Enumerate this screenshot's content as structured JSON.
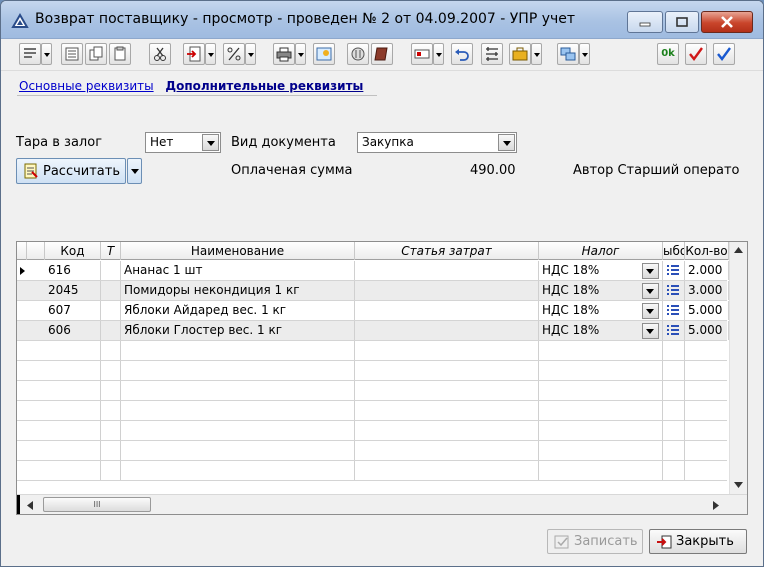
{
  "window": {
    "title": "Возврат поставщику - просмотр - проведен № 2 от 04.09.2007 - УПР учет"
  },
  "toolbar": {
    "ok_label": "0k"
  },
  "tabs": {
    "basic": "Основные реквизиты",
    "extra": "Дополнительные реквизиты"
  },
  "form": {
    "tara_label": "Тара в залог",
    "tara_value": "Нет",
    "doc_type_label": "Вид документа",
    "doc_type_value": "Закупка",
    "calc_button": "Рассчитать",
    "paid_label": "Оплаченая сумма",
    "paid_value": "490.00",
    "author_label": "Автор",
    "author_value": "Старший оператор"
  },
  "grid": {
    "headers": {
      "code": "Код",
      "t": "Т",
      "name": "Наименование",
      "cost_item": "Статья затрат",
      "tax": "Налог",
      "unit": "ыбо",
      "qty": "Кол-во"
    },
    "rows": [
      {
        "code": "616",
        "name": "Ананас 1 шт",
        "tax": "НДС 18%",
        "qty": "2.000"
      },
      {
        "code": "2045",
        "name": "Помидоры некондиция 1 кг",
        "tax": "НДС 18%",
        "qty": "3.000"
      },
      {
        "code": "607",
        "name": "Яблоки Айдаред вес. 1 кг",
        "tax": "НДС 18%",
        "qty": "5.000"
      },
      {
        "code": "606",
        "name": "Яблоки Глостер вес. 1 кг",
        "tax": "НДС 18%",
        "qty": "5.000"
      }
    ],
    "scroll_thumb": "III"
  },
  "footer": {
    "save_button": "Записать",
    "close_button": "Закрыть"
  }
}
